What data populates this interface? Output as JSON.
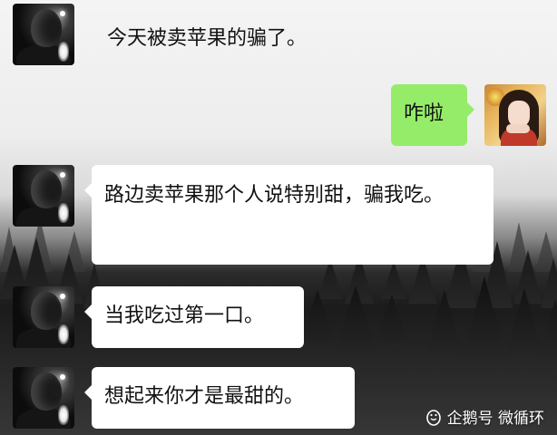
{
  "messages": [
    {
      "sender": "other",
      "text": "今天被卖苹果的骗了。"
    },
    {
      "sender": "me",
      "text": "咋啦"
    },
    {
      "sender": "other",
      "text": "路边卖苹果那个人说特别甜，骗我吃。"
    },
    {
      "sender": "other",
      "text": "当我吃过第一口。"
    },
    {
      "sender": "other",
      "text": "想起来你才是最甜的。"
    }
  ],
  "watermark": {
    "icon": "penguin-icon",
    "text": "企鹅号 微循环"
  },
  "colors": {
    "my_bubble": "#95ec69",
    "other_bubble": "#ffffff"
  }
}
